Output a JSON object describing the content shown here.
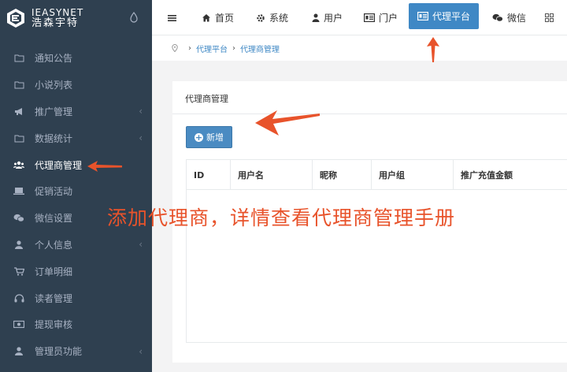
{
  "brand": {
    "name_en": "IEASYNET",
    "name_cn": "浩森宇特"
  },
  "sidebar": {
    "items": [
      {
        "label": "通知公告",
        "icon": "folder-icon",
        "chevron": false
      },
      {
        "label": "小说列表",
        "icon": "folder-icon",
        "chevron": false
      },
      {
        "label": "推广管理",
        "icon": "bullhorn-icon",
        "chevron": true
      },
      {
        "label": "数据统计",
        "icon": "folder-icon",
        "chevron": true
      },
      {
        "label": "代理商管理",
        "icon": "users-icon",
        "chevron": false
      },
      {
        "label": "促销活动",
        "icon": "laptop-icon",
        "chevron": false
      },
      {
        "label": "微信设置",
        "icon": "wechat-icon",
        "chevron": false
      },
      {
        "label": "个人信息",
        "icon": "user-icon",
        "chevron": true
      },
      {
        "label": "订单明细",
        "icon": "cart-icon",
        "chevron": false
      },
      {
        "label": "读者管理",
        "icon": "headphones-icon",
        "chevron": false
      },
      {
        "label": "提现审核",
        "icon": "money-icon",
        "chevron": false
      },
      {
        "label": "管理员功能",
        "icon": "user-icon",
        "chevron": true
      }
    ],
    "chevron_glyph": "‹"
  },
  "topnav": {
    "items": [
      {
        "label": "首页",
        "icon": "home-icon"
      },
      {
        "label": "系统",
        "icon": "gear-icon"
      },
      {
        "label": "用户",
        "icon": "user-icon"
      },
      {
        "label": "门户",
        "icon": "portal-icon"
      },
      {
        "label": "代理平台",
        "icon": "portal-icon",
        "active": true
      },
      {
        "label": "微信",
        "icon": "wechat-icon"
      }
    ]
  },
  "breadcrumb": {
    "items": [
      "代理平台",
      "代理商管理"
    ],
    "separator": "›"
  },
  "panel": {
    "title": "代理商管理",
    "add_button": "新增",
    "columns": [
      "ID",
      "用户名",
      "昵称",
      "用户组",
      "推广充值金额"
    ]
  },
  "annotation": {
    "text": "添加代理商，详情查看代理商管理手册",
    "color": "#e8532b"
  },
  "colors": {
    "sidebar_bg": "#2f4050",
    "accent": "#3f88c5",
    "annotation": "#e8532b"
  }
}
